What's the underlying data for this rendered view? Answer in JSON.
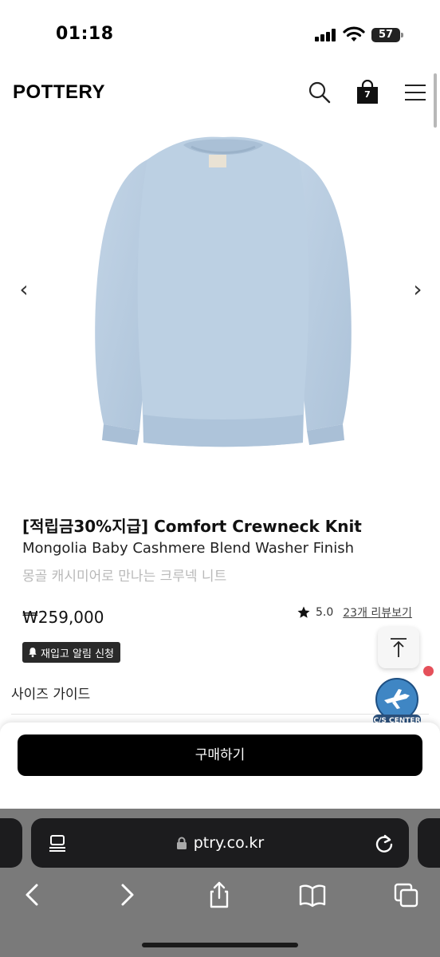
{
  "status": {
    "time": "01:18",
    "battery": "57"
  },
  "header": {
    "logo": "POTTERY",
    "cart_count": "7"
  },
  "product": {
    "title": "[적립금30%지급] Comfort Crewneck Knit",
    "subtitle": "Mongolia Baby Cashmere Blend Washer Finish",
    "description": "몽골 캐시미어로 만나는 크루넥 니트",
    "price": "₩259,000",
    "rating": "5.0",
    "review_link": "23개 리뷰보기",
    "restock_label": "재입고 알림 신청",
    "size_guide": "사이즈 가이드",
    "image_color": "#b9cde0"
  },
  "cs_center_label": "C/S CENTER",
  "buy_button": "구매하기",
  "browser": {
    "url": "ptry.co.kr"
  },
  "colors": {
    "accent": "#000000",
    "notification_dot": "#e5505a",
    "browser_bar": "#7a7a7a"
  }
}
